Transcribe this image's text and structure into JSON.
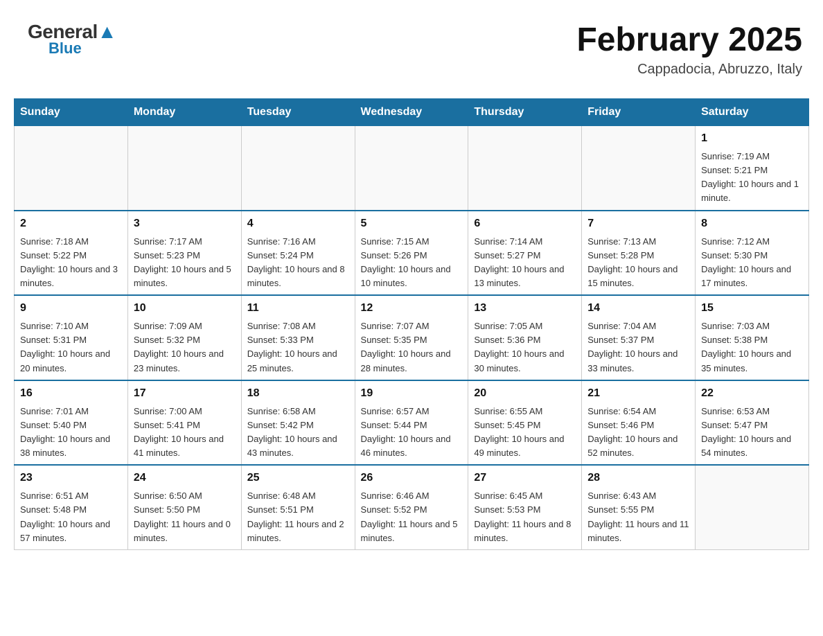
{
  "header": {
    "logo_general": "General",
    "logo_blue": "Blue",
    "title": "February 2025",
    "subtitle": "Cappadocia, Abruzzo, Italy"
  },
  "weekdays": [
    "Sunday",
    "Monday",
    "Tuesday",
    "Wednesday",
    "Thursday",
    "Friday",
    "Saturday"
  ],
  "weeks": [
    [
      {
        "day": "",
        "info": ""
      },
      {
        "day": "",
        "info": ""
      },
      {
        "day": "",
        "info": ""
      },
      {
        "day": "",
        "info": ""
      },
      {
        "day": "",
        "info": ""
      },
      {
        "day": "",
        "info": ""
      },
      {
        "day": "1",
        "info": "Sunrise: 7:19 AM\nSunset: 5:21 PM\nDaylight: 10 hours and 1 minute."
      }
    ],
    [
      {
        "day": "2",
        "info": "Sunrise: 7:18 AM\nSunset: 5:22 PM\nDaylight: 10 hours and 3 minutes."
      },
      {
        "day": "3",
        "info": "Sunrise: 7:17 AM\nSunset: 5:23 PM\nDaylight: 10 hours and 5 minutes."
      },
      {
        "day": "4",
        "info": "Sunrise: 7:16 AM\nSunset: 5:24 PM\nDaylight: 10 hours and 8 minutes."
      },
      {
        "day": "5",
        "info": "Sunrise: 7:15 AM\nSunset: 5:26 PM\nDaylight: 10 hours and 10 minutes."
      },
      {
        "day": "6",
        "info": "Sunrise: 7:14 AM\nSunset: 5:27 PM\nDaylight: 10 hours and 13 minutes."
      },
      {
        "day": "7",
        "info": "Sunrise: 7:13 AM\nSunset: 5:28 PM\nDaylight: 10 hours and 15 minutes."
      },
      {
        "day": "8",
        "info": "Sunrise: 7:12 AM\nSunset: 5:30 PM\nDaylight: 10 hours and 17 minutes."
      }
    ],
    [
      {
        "day": "9",
        "info": "Sunrise: 7:10 AM\nSunset: 5:31 PM\nDaylight: 10 hours and 20 minutes."
      },
      {
        "day": "10",
        "info": "Sunrise: 7:09 AM\nSunset: 5:32 PM\nDaylight: 10 hours and 23 minutes."
      },
      {
        "day": "11",
        "info": "Sunrise: 7:08 AM\nSunset: 5:33 PM\nDaylight: 10 hours and 25 minutes."
      },
      {
        "day": "12",
        "info": "Sunrise: 7:07 AM\nSunset: 5:35 PM\nDaylight: 10 hours and 28 minutes."
      },
      {
        "day": "13",
        "info": "Sunrise: 7:05 AM\nSunset: 5:36 PM\nDaylight: 10 hours and 30 minutes."
      },
      {
        "day": "14",
        "info": "Sunrise: 7:04 AM\nSunset: 5:37 PM\nDaylight: 10 hours and 33 minutes."
      },
      {
        "day": "15",
        "info": "Sunrise: 7:03 AM\nSunset: 5:38 PM\nDaylight: 10 hours and 35 minutes."
      }
    ],
    [
      {
        "day": "16",
        "info": "Sunrise: 7:01 AM\nSunset: 5:40 PM\nDaylight: 10 hours and 38 minutes."
      },
      {
        "day": "17",
        "info": "Sunrise: 7:00 AM\nSunset: 5:41 PM\nDaylight: 10 hours and 41 minutes."
      },
      {
        "day": "18",
        "info": "Sunrise: 6:58 AM\nSunset: 5:42 PM\nDaylight: 10 hours and 43 minutes."
      },
      {
        "day": "19",
        "info": "Sunrise: 6:57 AM\nSunset: 5:44 PM\nDaylight: 10 hours and 46 minutes."
      },
      {
        "day": "20",
        "info": "Sunrise: 6:55 AM\nSunset: 5:45 PM\nDaylight: 10 hours and 49 minutes."
      },
      {
        "day": "21",
        "info": "Sunrise: 6:54 AM\nSunset: 5:46 PM\nDaylight: 10 hours and 52 minutes."
      },
      {
        "day": "22",
        "info": "Sunrise: 6:53 AM\nSunset: 5:47 PM\nDaylight: 10 hours and 54 minutes."
      }
    ],
    [
      {
        "day": "23",
        "info": "Sunrise: 6:51 AM\nSunset: 5:48 PM\nDaylight: 10 hours and 57 minutes."
      },
      {
        "day": "24",
        "info": "Sunrise: 6:50 AM\nSunset: 5:50 PM\nDaylight: 11 hours and 0 minutes."
      },
      {
        "day": "25",
        "info": "Sunrise: 6:48 AM\nSunset: 5:51 PM\nDaylight: 11 hours and 2 minutes."
      },
      {
        "day": "26",
        "info": "Sunrise: 6:46 AM\nSunset: 5:52 PM\nDaylight: 11 hours and 5 minutes."
      },
      {
        "day": "27",
        "info": "Sunrise: 6:45 AM\nSunset: 5:53 PM\nDaylight: 11 hours and 8 minutes."
      },
      {
        "day": "28",
        "info": "Sunrise: 6:43 AM\nSunset: 5:55 PM\nDaylight: 11 hours and 11 minutes."
      },
      {
        "day": "",
        "info": ""
      }
    ]
  ]
}
